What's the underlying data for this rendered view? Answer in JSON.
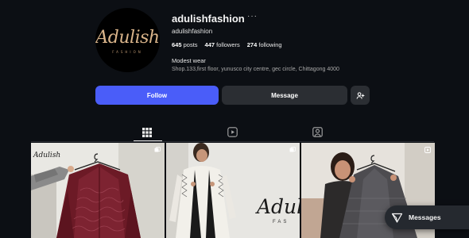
{
  "profile": {
    "username": "adulishfashion",
    "handle": "adulishfashion",
    "logo_script": "Adulish",
    "logo_sub": "FASHION",
    "stats": {
      "posts_count": "645",
      "posts_label": "posts",
      "followers_count": "447",
      "followers_label": "followers",
      "following_count": "274",
      "following_label": "following"
    },
    "bio_title": "Modest wear",
    "bio_address": "Shop.133,first floor, yunusco city centre, gec circle, Chittagong 4000"
  },
  "actions": {
    "follow_label": "Follow",
    "message_label": "Message",
    "suggest_icon": "add-person-icon"
  },
  "tabs": [
    {
      "name": "posts",
      "icon": "grid-icon",
      "active": true
    },
    {
      "name": "reels",
      "icon": "reels-icon",
      "active": false
    },
    {
      "name": "tagged",
      "icon": "tagged-icon",
      "active": false
    }
  ],
  "posts": [
    {
      "overlay_text": "Adulish",
      "corner_icon": "carousel-icon"
    },
    {
      "overlay_text": "Adul",
      "overlay_sub": "FAS",
      "corner_icon": "carousel-icon"
    },
    {
      "corner_icon": "reel-icon"
    }
  ],
  "messages_pill": {
    "label": "Messages",
    "icon": "send-icon"
  },
  "colors": {
    "background": "#0c0f14",
    "follow_button": "#4a5df9",
    "secondary_button": "#2b2e33",
    "logo_gold": "#d9b48a"
  }
}
